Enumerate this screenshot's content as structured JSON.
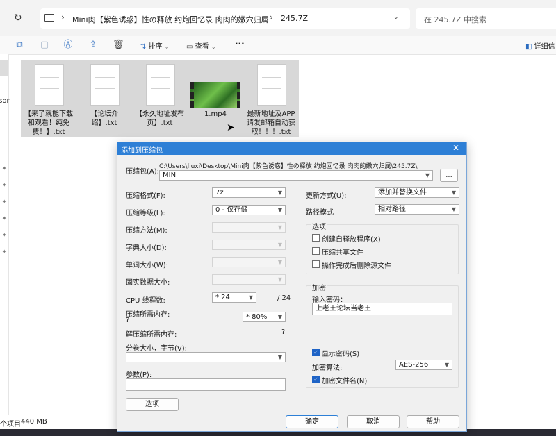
{
  "address": {
    "path_segments": [
      "Mini肉【紫色诱惑】性の释放 约炮回忆录 肉肉的嫩穴归属",
      "245.7Z"
    ],
    "search_placeholder": "在 245.7Z 中搜索"
  },
  "toolbar": {
    "sort_label": "排序",
    "view_label": "查看",
    "more_label": "···",
    "details_label": "详细信"
  },
  "left_fragment": "rsor",
  "files": [
    {
      "name": "【来了就能下载和观看！纯免费！】.txt",
      "type": "txt"
    },
    {
      "name": "【论坛介绍】.txt",
      "type": "txt"
    },
    {
      "name": "【永久地址发布页】.txt",
      "type": "txt"
    },
    {
      "name": "1.mp4",
      "type": "video"
    },
    {
      "name": "最新地址及APP请发邮箱自动获取！！！.txt",
      "type": "txt"
    }
  ],
  "status": {
    "items": "个项目",
    "size": "440 MB"
  },
  "dialog": {
    "title": "添加到压缩包",
    "archive_label": "压缩包(A):",
    "archive_path": "C:\\Users\\liuxi\\Desktop\\Mini肉【紫色诱惑】性の释放 约炮回忆录 肉肉的嫩穴归属\\245.7Z\\",
    "archive_name": "MIN",
    "browse_label": "...",
    "format_label": "压缩格式(F):",
    "format_value": "7z",
    "level_label": "压缩等级(L):",
    "level_value": "0 - 仅存储",
    "method_label": "压缩方法(M):",
    "dict_label": "字典大小(D):",
    "word_label": "单词大小(W):",
    "solid_label": "固实数据大小:",
    "cpu_label": "CPU 线程数:",
    "cpu_value": "* 24",
    "cpu_total": "/ 24",
    "mem_comp_label": "压缩所需内存:",
    "mem_comp_q": "?",
    "mem_comp_value": "* 80%",
    "mem_decomp_label": "解压缩所需内存:",
    "mem_decomp_q": "?",
    "split_label": "分卷大小，字节(V):",
    "params_label": "参数(P):",
    "options_button": "选项",
    "update_label": "更新方式(U):",
    "update_value": "添加并替换文件",
    "path_mode_label": "路径模式",
    "path_mode_value": "相对路径",
    "options_group": "选项",
    "opt_sfx": "创建自释放程序(X)",
    "opt_shared": "压缩共享文件",
    "opt_delete": "操作完成后删除源文件",
    "encrypt_group": "加密",
    "password_label": "输入密码：",
    "password_value": "上老王论坛当老王",
    "show_password": "显示密码(S)",
    "enc_method_label": "加密算法:",
    "enc_method_value": "AES-256",
    "encrypt_names": "加密文件名(N)",
    "ok": "确定",
    "cancel": "取消",
    "help": "帮助"
  }
}
